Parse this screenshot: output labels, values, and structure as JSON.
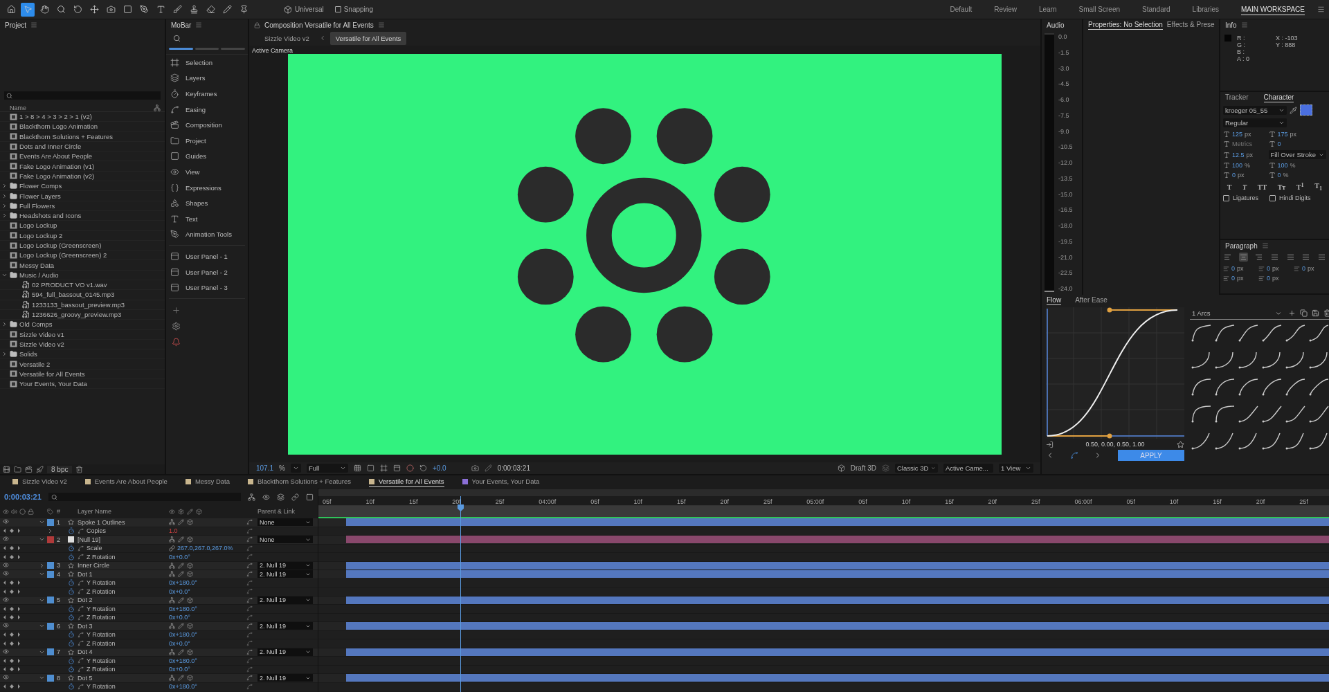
{
  "toolbar": {
    "tools": [
      {
        "selected": false
      },
      {
        "selected": true
      },
      {
        "selected": false
      },
      {
        "selected": false
      },
      {
        "selected": false
      },
      {
        "selected": false
      },
      {
        "selected": false
      },
      {
        "selected": false
      },
      {
        "selected": false
      },
      {
        "selected": false
      },
      {
        "selected": false
      },
      {
        "selected": false
      },
      {
        "selected": false
      },
      {
        "selected": false
      },
      {
        "selected": false
      }
    ],
    "axis_mode": "Universal",
    "snapping": {
      "label": "Snapping",
      "checked": false
    },
    "workspaces": [
      {
        "label": "Default",
        "selected": false
      },
      {
        "label": "Review",
        "selected": false
      },
      {
        "label": "Learn",
        "selected": false
      },
      {
        "label": "Small Screen",
        "selected": false
      },
      {
        "label": "Standard",
        "selected": false
      },
      {
        "label": "Libraries",
        "selected": false
      },
      {
        "label": "MAIN WORKSPACE",
        "selected": true
      }
    ]
  },
  "project": {
    "title": "Project",
    "column": "Name",
    "bpc": "8 bpc",
    "items": [
      {
        "name": "1 > 8 > 4 > 3 > 2 > 1 (v2)",
        "kind": "comp"
      },
      {
        "name": "Blackthorn Logo Animation",
        "kind": "comp"
      },
      {
        "name": "Blackthorn Solutions + Features",
        "kind": "comp"
      },
      {
        "name": "Dots and Inner Circle",
        "kind": "comp"
      },
      {
        "name": "Events Are About People",
        "kind": "comp"
      },
      {
        "name": "Fake Logo Animation (v1)",
        "kind": "comp"
      },
      {
        "name": "Fake Logo Animation (v2)",
        "kind": "comp"
      },
      {
        "name": "Flower Comps",
        "kind": "folder",
        "expanded": false
      },
      {
        "name": "Flower Layers",
        "kind": "folder",
        "expanded": false
      },
      {
        "name": "Full Flowers",
        "kind": "folder",
        "expanded": false
      },
      {
        "name": "Headshots and Icons",
        "kind": "folder",
        "expanded": false
      },
      {
        "name": "Logo Lockup",
        "kind": "comp"
      },
      {
        "name": "Logo Lockup 2",
        "kind": "comp"
      },
      {
        "name": "Logo Lockup (Greenscreen)",
        "kind": "comp"
      },
      {
        "name": "Logo Lockup (Greenscreen) 2",
        "kind": "comp"
      },
      {
        "name": "Messy Data",
        "kind": "comp"
      },
      {
        "name": "Music / Audio",
        "kind": "folder",
        "expanded": true,
        "children": [
          {
            "name": "02 PRODUCT VO v1.wav",
            "kind": "audio"
          },
          {
            "name": "594_full_bassout_0145.mp3",
            "kind": "audio"
          },
          {
            "name": "1233133_bassout_preview.mp3",
            "kind": "audio"
          },
          {
            "name": "1236626_groovy_preview.mp3",
            "kind": "audio"
          }
        ]
      },
      {
        "name": "Old Comps",
        "kind": "folder",
        "expanded": false
      },
      {
        "name": "Sizzle Video v1",
        "kind": "comp"
      },
      {
        "name": "Sizzle Video v2",
        "kind": "comp"
      },
      {
        "name": "Solids",
        "kind": "folder",
        "expanded": false
      },
      {
        "name": "Versatile 2",
        "kind": "comp"
      },
      {
        "name": "Versatile for All Events",
        "kind": "comp"
      },
      {
        "name": "Your Events, Your Data",
        "kind": "comp"
      }
    ]
  },
  "mobar": {
    "title": "MoBar",
    "items": [
      {
        "label": "Selection"
      },
      {
        "label": "Layers"
      },
      {
        "label": "Keyframes"
      },
      {
        "label": "Easing"
      },
      {
        "label": "Composition"
      },
      {
        "label": "Project"
      },
      {
        "label": "Guides"
      },
      {
        "label": "View"
      },
      {
        "label": "Expressions"
      },
      {
        "label": "Shapes"
      },
      {
        "label": "Text"
      },
      {
        "label": "Animation Tools"
      }
    ],
    "user_panels": [
      {
        "label": "User Panel - 1"
      },
      {
        "label": "User Panel - 2"
      },
      {
        "label": "User Panel - 3"
      }
    ]
  },
  "composition": {
    "title": "Composition Versatile for All Events",
    "breadcrumbs": [
      {
        "label": "Sizzle Video v2",
        "selected": false
      },
      {
        "label": "Versatile for All Events",
        "selected": true
      }
    ],
    "camera_label": "Active Camera",
    "zoom": "107.1",
    "zoom_unit": "%",
    "resolution": "Full",
    "exposure": "+0.0",
    "timecode": "0:00:03:21",
    "draft": "Draft 3D",
    "renderer": "Classic 3D",
    "view": "Active Came...",
    "views": "1 View"
  },
  "audio": {
    "title": "Audio",
    "scale": [
      "0.0",
      "-1.5",
      "-3.0",
      "-4.5",
      "-6.0",
      "-7.5",
      "-9.0",
      "-10.5",
      "-12.0",
      "-13.5",
      "-15.0",
      "-16.5",
      "-18.0",
      "-19.5",
      "-21.0",
      "-22.5",
      "-24.0"
    ]
  },
  "properties": {
    "tabs": [
      {
        "label": "Properties: No Selection",
        "selected": true
      },
      {
        "label": "Effects & Prese",
        "selected": false
      }
    ]
  },
  "info": {
    "title": "Info",
    "channels": [
      "R :",
      "G :",
      "B :",
      "A :  0"
    ],
    "x": "X : -103",
    "y": "Y :  888"
  },
  "character": {
    "tabs": [
      {
        "label": "Tracker",
        "selected": false
      },
      {
        "label": "Character",
        "selected": true
      }
    ],
    "font": "kroeger 05_55",
    "style": "Regular",
    "fields": [
      {
        "kind": "value",
        "value": "125",
        "unit": "px"
      },
      {
        "kind": "value",
        "value": "175",
        "unit": "px"
      },
      {
        "kind": "muted",
        "value": "Metrics"
      },
      {
        "kind": "value",
        "value": "0"
      },
      {
        "kind": "value",
        "value": "12.5",
        "unit": "px"
      },
      {
        "kind": "dropdown",
        "value": "Fill Over Stroke"
      },
      {
        "kind": "value",
        "value": "100",
        "unit": "%"
      },
      {
        "kind": "value",
        "value": "100",
        "unit": "%"
      },
      {
        "kind": "value",
        "value": "0",
        "unit": "px"
      },
      {
        "kind": "value",
        "value": "0",
        "unit": "%"
      }
    ],
    "styles": [
      "T",
      "T",
      "TT",
      "Tт",
      "T$^{1}$",
      "T$_{1}$"
    ],
    "options": [
      {
        "label": "Ligatures",
        "checked": false
      },
      {
        "label": "Hindi Digits",
        "checked": false
      }
    ]
  },
  "paragraph": {
    "title": "Paragraph",
    "align": [
      {
        "selected": false
      },
      {
        "selected": true
      },
      {
        "selected": false
      },
      {
        "selected": false
      },
      {
        "selected": false
      },
      {
        "selected": false
      },
      {
        "selected": false
      }
    ],
    "fields": [
      {
        "value": "0",
        "unit": "px"
      },
      {
        "value": "0",
        "unit": "px"
      },
      {
        "value": "0",
        "unit": "px"
      },
      {
        "value": "0",
        "unit": "px"
      },
      {
        "value": "0",
        "unit": "px"
      }
    ]
  },
  "flow": {
    "tabs": [
      {
        "label": "Flow",
        "selected": true
      },
      {
        "label": "After Ease",
        "selected": false
      }
    ],
    "values": "0.50, 0.00, 0.50, 1.00",
    "apply": "APPLY",
    "preset_group": "1 Arcs"
  },
  "timeline": {
    "tabs": [
      {
        "label": "Sizzle Video v2",
        "selected": false,
        "color": "#c9b68e"
      },
      {
        "label": "Events Are About People",
        "selected": false,
        "color": "#c9b68e"
      },
      {
        "label": "Messy Data",
        "selected": false,
        "color": "#c9b68e"
      },
      {
        "label": "Blackthorn Solutions + Features",
        "selected": false,
        "color": "#c9b68e"
      },
      {
        "label": "Versatile for All Events",
        "selected": true,
        "color": "#c9b68e"
      },
      {
        "label": "Your Events, Your Data",
        "selected": false,
        "color": "#8b6fd6"
      }
    ],
    "time": "0:00:03:21",
    "column_number": "#",
    "column_name": "Layer Name",
    "column_parent": "Parent & Link",
    "ruler": [
      "05f",
      "10f",
      "15f",
      "20f",
      "25f",
      "04:00f",
      "05f",
      "10f",
      "15f",
      "20f",
      "25f",
      "05:00f",
      "05f",
      "10f",
      "15f",
      "20f",
      "25f",
      "06:00f",
      "05f",
      "10f",
      "15f",
      "20f",
      "25f"
    ],
    "rows": [
      {
        "kind": "layer",
        "number": "1",
        "name": "Spoke 1 Outlines",
        "color": "#4f8ed0",
        "expanded": true,
        "parent": "None"
      },
      {
        "kind": "property",
        "name": "Copies",
        "value": "1.0",
        "invalid": true,
        "expandable": true
      },
      {
        "kind": "null_layer",
        "number": "2",
        "name": "[Null 19]",
        "color": "#b03a3a",
        "expanded": true,
        "parent": "None"
      },
      {
        "kind": "property",
        "name": "Scale",
        "value": "267.0,267.0,267.0%",
        "invalid": false,
        "linked": true
      },
      {
        "kind": "property",
        "name": "Z Rotation",
        "value": "0x+0.0°",
        "invalid": false
      },
      {
        "kind": "layer",
        "number": "3",
        "name": "Inner Circle",
        "color": "#4f8ed0",
        "expanded": false,
        "parent": "2. Null 19"
      },
      {
        "kind": "layer",
        "number": "4",
        "name": "Dot 1",
        "color": "#4f8ed0",
        "expanded": true,
        "parent": "2. Null 19"
      },
      {
        "kind": "property",
        "name": "Y Rotation",
        "value": "0x+180.0°",
        "invalid": false
      },
      {
        "kind": "property",
        "name": "Z Rotation",
        "value": "0x+0.0°",
        "invalid": false
      },
      {
        "kind": "layer",
        "number": "5",
        "name": "Dot 2",
        "color": "#4f8ed0",
        "expanded": true,
        "parent": "2. Null 19"
      },
      {
        "kind": "property",
        "name": "Y Rotation",
        "value": "0x+180.0°",
        "invalid": false
      },
      {
        "kind": "property",
        "name": "Z Rotation",
        "value": "0x+0.0°",
        "invalid": false
      },
      {
        "kind": "layer",
        "number": "6",
        "name": "Dot 3",
        "color": "#4f8ed0",
        "expanded": true,
        "parent": "2. Null 19"
      },
      {
        "kind": "property",
        "name": "Y Rotation",
        "value": "0x+180.0°",
        "invalid": false
      },
      {
        "kind": "property",
        "name": "Z Rotation",
        "value": "0x+0.0°",
        "invalid": false
      },
      {
        "kind": "layer",
        "number": "7",
        "name": "Dot 4",
        "color": "#4f8ed0",
        "expanded": true,
        "parent": "2. Null 19"
      },
      {
        "kind": "property",
        "name": "Y Rotation",
        "value": "0x+180.0°",
        "invalid": false
      },
      {
        "kind": "property",
        "name": "Z Rotation",
        "value": "0x+0.0°",
        "invalid": false
      },
      {
        "kind": "layer",
        "number": "8",
        "name": "Dot 5",
        "color": "#4f8ed0",
        "expanded": true,
        "parent": "2. Null 19"
      },
      {
        "kind": "property",
        "name": "Y Rotation",
        "value": "0x+180.0°",
        "invalid": false
      }
    ]
  }
}
